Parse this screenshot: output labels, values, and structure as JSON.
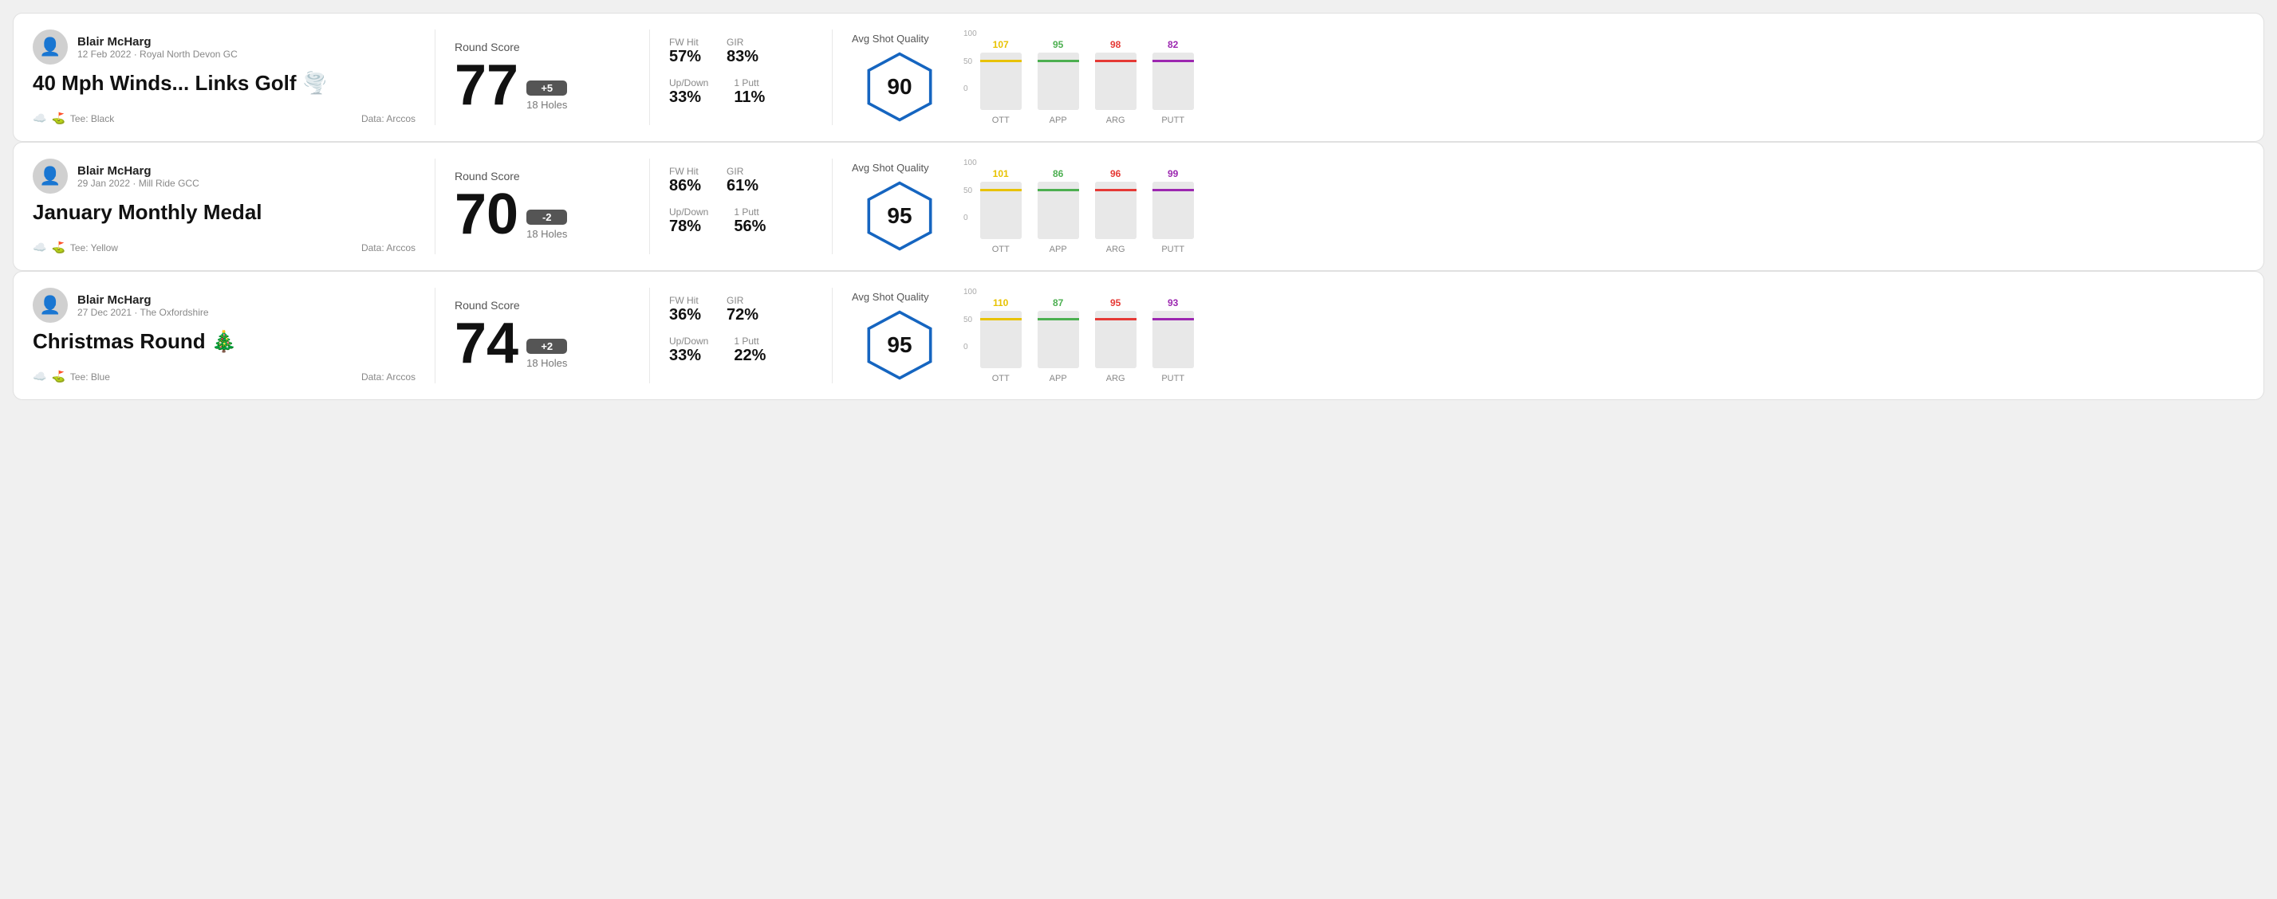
{
  "rounds": [
    {
      "id": "round1",
      "user_name": "Blair McHarg",
      "date_course": "12 Feb 2022 · Royal North Devon GC",
      "title": "40 Mph Winds... Links Golf",
      "title_emoji": "🌪️",
      "tee": "Black",
      "data_source": "Data: Arccos",
      "score": "77",
      "score_diff": "+5",
      "holes": "18 Holes",
      "fw_hit": "57%",
      "gir": "83%",
      "up_down": "33%",
      "one_putt": "11%",
      "avg_quality": "90",
      "chart": {
        "bars": [
          {
            "label": "OTT",
            "value": 107,
            "color": "#e8c200",
            "max": 100
          },
          {
            "label": "APP",
            "value": 95,
            "color": "#4caf50",
            "max": 100
          },
          {
            "label": "ARG",
            "value": 98,
            "color": "#e53935",
            "max": 100
          },
          {
            "label": "PUTT",
            "value": 82,
            "color": "#9c27b0",
            "max": 100
          }
        ]
      }
    },
    {
      "id": "round2",
      "user_name": "Blair McHarg",
      "date_course": "29 Jan 2022 · Mill Ride GCC",
      "title": "January Monthly Medal",
      "title_emoji": "",
      "tee": "Yellow",
      "data_source": "Data: Arccos",
      "score": "70",
      "score_diff": "-2",
      "holes": "18 Holes",
      "fw_hit": "86%",
      "gir": "61%",
      "up_down": "78%",
      "one_putt": "56%",
      "avg_quality": "95",
      "chart": {
        "bars": [
          {
            "label": "OTT",
            "value": 101,
            "color": "#e8c200",
            "max": 100
          },
          {
            "label": "APP",
            "value": 86,
            "color": "#4caf50",
            "max": 100
          },
          {
            "label": "ARG",
            "value": 96,
            "color": "#e53935",
            "max": 100
          },
          {
            "label": "PUTT",
            "value": 99,
            "color": "#9c27b0",
            "max": 100
          }
        ]
      }
    },
    {
      "id": "round3",
      "user_name": "Blair McHarg",
      "date_course": "27 Dec 2021 · The Oxfordshire",
      "title": "Christmas Round",
      "title_emoji": "🎄",
      "tee": "Blue",
      "data_source": "Data: Arccos",
      "score": "74",
      "score_diff": "+2",
      "holes": "18 Holes",
      "fw_hit": "36%",
      "gir": "72%",
      "up_down": "33%",
      "one_putt": "22%",
      "avg_quality": "95",
      "chart": {
        "bars": [
          {
            "label": "OTT",
            "value": 110,
            "color": "#e8c200",
            "max": 100
          },
          {
            "label": "APP",
            "value": 87,
            "color": "#4caf50",
            "max": 100
          },
          {
            "label": "ARG",
            "value": 95,
            "color": "#e53935",
            "max": 100
          },
          {
            "label": "PUTT",
            "value": 93,
            "color": "#9c27b0",
            "max": 100
          }
        ]
      }
    }
  ],
  "labels": {
    "fw_hit": "FW Hit",
    "gir": "GIR",
    "up_down": "Up/Down",
    "one_putt": "1 Putt",
    "avg_shot_quality": "Avg Shot Quality",
    "round_score": "Round Score",
    "chart_axis_100": "100",
    "chart_axis_50": "50",
    "chart_axis_0": "0"
  }
}
